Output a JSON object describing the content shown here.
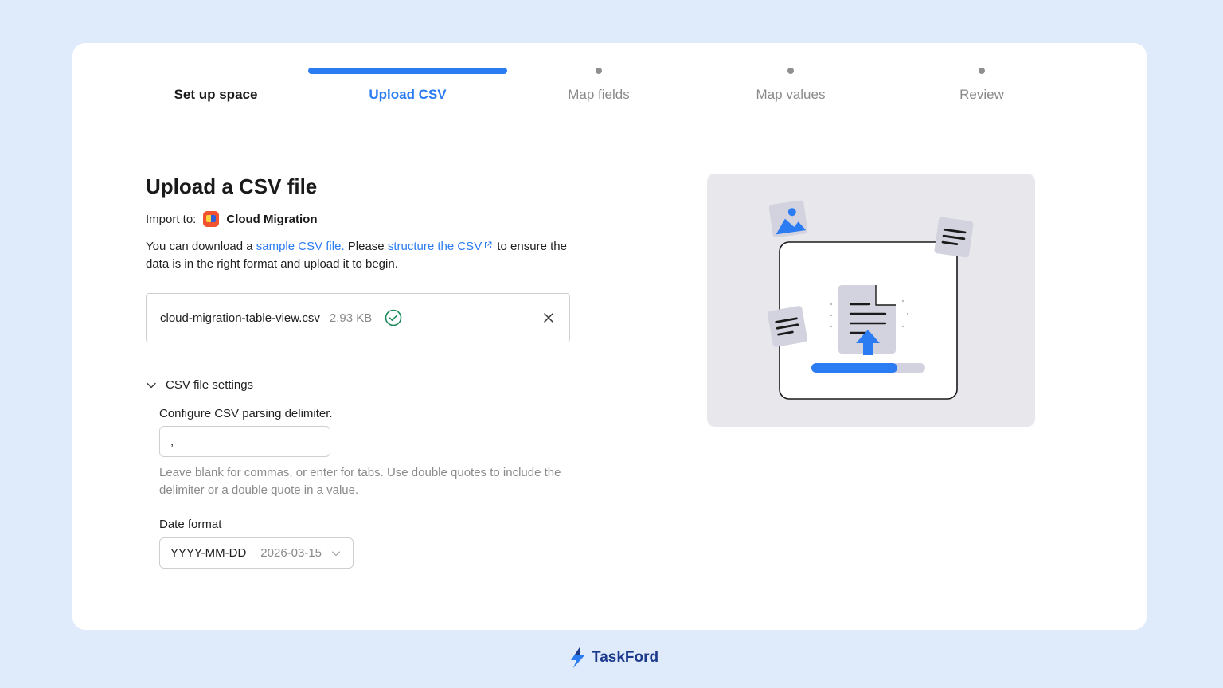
{
  "stepper": {
    "steps": [
      {
        "label": "Set up space",
        "state": "done"
      },
      {
        "label": "Upload CSV",
        "state": "active"
      },
      {
        "label": "Map fields",
        "state": "pending"
      },
      {
        "label": "Map values",
        "state": "pending"
      },
      {
        "label": "Review",
        "state": "pending"
      }
    ]
  },
  "main": {
    "title": "Upload a CSV file",
    "import_label": "Import to:",
    "space_name": "Cloud Migration",
    "desc_part1": "You can download a ",
    "sample_link": "sample CSV file.",
    "desc_part2": " Please ",
    "structure_link": "structure the CSV",
    "desc_part3": " to ensure the data is in the right format and upload it to begin.",
    "file": {
      "name": "cloud-migration-table-view.csv",
      "size": "2.93 KB"
    },
    "settings": {
      "toggle_label": "CSV file settings",
      "delimiter_label": "Configure CSV parsing delimiter.",
      "delimiter_value": ",",
      "help_text": "Leave blank for commas, or enter for tabs. Use double quotes to include the delimiter or a double quote in a value.",
      "date_label": "Date format",
      "date_format": "YYYY-MM-DD",
      "date_example": "2026-03-15"
    }
  },
  "brand": {
    "name": "TaskFord"
  },
  "colors": {
    "accent": "#2b7cf3",
    "success": "#1a8a5a",
    "background": "#dfeafb",
    "brand": "#1b3a8c"
  },
  "icons": {
    "space": "space-icon",
    "external_link": "external-link-icon",
    "success": "check-circle-icon",
    "close": "close-icon",
    "expand": "chevron-down-icon",
    "select": "chevron-down-icon",
    "logo": "taskford-logo-icon"
  }
}
